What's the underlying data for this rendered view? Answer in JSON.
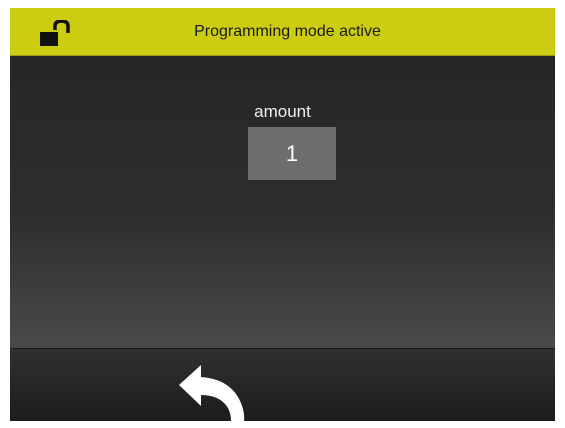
{
  "status_bar": {
    "title": "Programming mode active",
    "lock_icon": "lock-open-icon",
    "color": "#cccc11"
  },
  "main": {
    "field_label": "amount",
    "field_value": "1"
  },
  "bottom_bar": {
    "back_icon": "back-arrow-icon"
  }
}
